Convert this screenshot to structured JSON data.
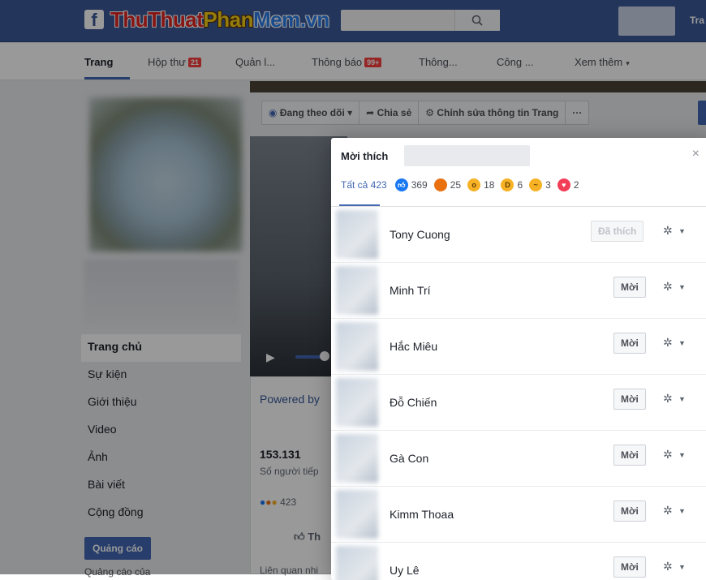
{
  "header": {
    "logo_f": "f",
    "logo_part1": "ThuThuat",
    "logo_part2": "Phan",
    "logo_part3": "Mem.vn",
    "search_icon": "search-icon",
    "user_label": "Tra"
  },
  "tabs": [
    {
      "label": "Trang"
    },
    {
      "label": "Hộp thư",
      "badge": "21"
    },
    {
      "label": "Quản l..."
    },
    {
      "label": "Thông báo",
      "badge": "99+"
    },
    {
      "label": "Thông..."
    },
    {
      "label": "Công ..."
    },
    {
      "label": "Xem thêm",
      "caret": "▾"
    }
  ],
  "actions": {
    "follow": "Đang theo dõi ▾",
    "share": "Chia sẻ",
    "edit": "Chỉnh sửa thông tin Trang",
    "more": "···"
  },
  "left_nav": [
    "Trang chủ",
    "Sự kiện",
    "Giới thiệu",
    "Video",
    "Ảnh",
    "Bài viết",
    "Cộng đồng"
  ],
  "ads_button": "Quảng cáo",
  "left_bottom_text": "Quảng cáo của",
  "middle": {
    "powered": "Powered by",
    "likes_count": "153.131",
    "likes_sub": "Số người tiếp",
    "mini_reacts": "423",
    "like_btn": "Th",
    "related": "Liên quan nhi"
  },
  "dialog": {
    "title": "Mời thích",
    "close": "×",
    "tabs": [
      {
        "label": "Tất cả 423",
        "icon": "",
        "kind": "all"
      },
      {
        "label": "369",
        "icon": "like-icon",
        "kind": "like"
      },
      {
        "label": "25",
        "icon": "angry-icon",
        "kind": "angry"
      },
      {
        "label": "18",
        "icon": "wow-icon",
        "kind": "wow"
      },
      {
        "label": "6",
        "icon": "haha-icon",
        "kind": "haha"
      },
      {
        "label": "3",
        "icon": "sad-icon",
        "kind": "sad"
      },
      {
        "label": "2",
        "icon": "love-icon",
        "kind": "love"
      }
    ],
    "people": [
      {
        "name": "Tony Cuong",
        "button": "Đã thích",
        "liked": true
      },
      {
        "name": "Minh Trí",
        "button": "Mời",
        "liked": false
      },
      {
        "name": "Hắc Miêu",
        "button": "Mời",
        "liked": false
      },
      {
        "name": "Đỗ Chiến",
        "button": "Mời",
        "liked": false
      },
      {
        "name": "Gà Con",
        "button": "Mời",
        "liked": false
      },
      {
        "name": "Kimm Thoaa",
        "button": "Mời",
        "liked": false
      },
      {
        "name": "Uy Lê",
        "button": "Mời",
        "liked": false
      }
    ]
  }
}
